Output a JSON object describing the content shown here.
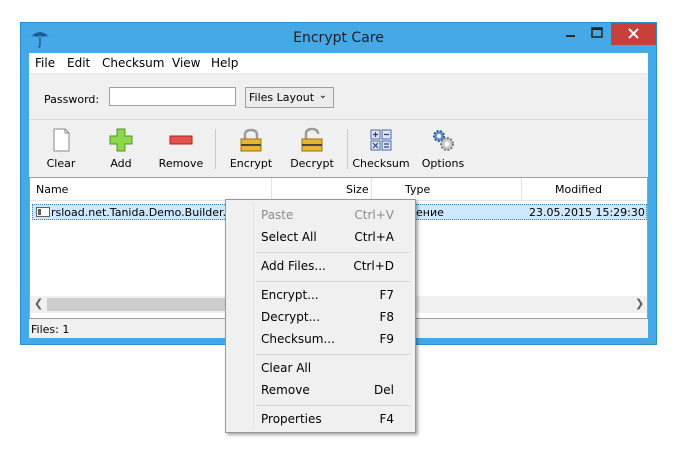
{
  "window": {
    "title": "Encrypt Care"
  },
  "menubar": [
    "File",
    "Edit",
    "Checksum",
    "View",
    "Help"
  ],
  "password": {
    "label": "Password:",
    "value": ""
  },
  "layout_select": {
    "value": "Files Layout"
  },
  "toolbar": {
    "clear": "Clear",
    "add": "Add",
    "remove": "Remove",
    "encrypt": "Encrypt",
    "decrypt": "Decrypt",
    "checksum": "Checksum",
    "options": "Options"
  },
  "list": {
    "columns": {
      "name": "Name",
      "size": "Size",
      "type": "Type",
      "modified": "Modified"
    },
    "rows": [
      {
        "name": "rsload.net.Tanida.Demo.Builder.10.0",
        "type": "ение",
        "modified": "23.05.2015 15:29:30"
      }
    ]
  },
  "status": {
    "files": "Files: 1"
  },
  "context_menu": {
    "paste": {
      "label": "Paste",
      "shortcut": "Ctrl+V"
    },
    "select_all": {
      "label": "Select All",
      "shortcut": "Ctrl+A"
    },
    "add_files": {
      "label": "Add Files...",
      "shortcut": "Ctrl+D"
    },
    "encrypt": {
      "label": "Encrypt...",
      "shortcut": "F7"
    },
    "decrypt": {
      "label": "Decrypt...",
      "shortcut": "F8"
    },
    "checksum": {
      "label": "Checksum...",
      "shortcut": "F9"
    },
    "clear_all": {
      "label": "Clear All",
      "shortcut": ""
    },
    "remove": {
      "label": "Remove",
      "shortcut": "Del"
    },
    "properties": {
      "label": "Properties",
      "shortcut": "F4"
    }
  },
  "icons": {
    "app": "umbrella-icon",
    "clear": "blank-file-icon",
    "add": "plus-icon",
    "remove": "minus-icon",
    "encrypt": "lock-closed-icon",
    "decrypt": "lock-open-icon",
    "checksum": "calculator-icon",
    "options": "gears-icon"
  },
  "colors": {
    "titlebar": "#44a9e6",
    "close": "#c7403a",
    "selection": "#cde8ff"
  }
}
